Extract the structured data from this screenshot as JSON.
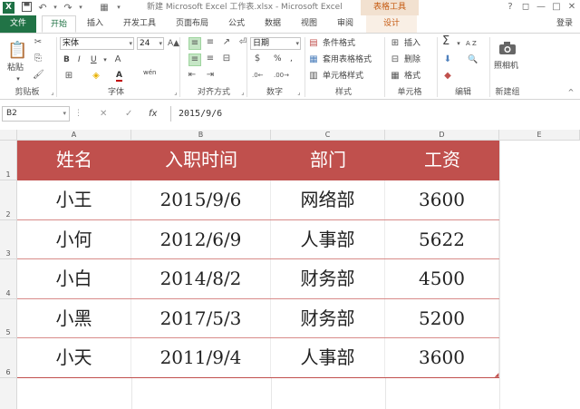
{
  "titlebar": {
    "logo": "X",
    "title": "新建 Microsoft Excel 工作表.xlsx - Microsoft Excel",
    "tool_context": "表格工具",
    "help": "?",
    "restore": "◻",
    "minimize": "—",
    "maximize": "□",
    "close": "✕"
  },
  "tabs": {
    "file": "文件",
    "home": "开始",
    "insert": "插入",
    "developer": "开发工具",
    "page_layout": "页面布局",
    "formulas": "公式",
    "data": "数据",
    "view": "视图",
    "review": "审阅",
    "design": "设计",
    "login": "登录"
  },
  "ribbon": {
    "clipboard": {
      "paste": "粘贴",
      "label": "剪贴板"
    },
    "font": {
      "name": "宋体",
      "size": "24",
      "bold": "B",
      "italic": "I",
      "underline": "U",
      "font_color": "A",
      "wen": "wén",
      "label": "字体"
    },
    "alignment": {
      "label": "对齐方式"
    },
    "number": {
      "format": "日期",
      "percent": "%",
      "comma": ",",
      "label": "数字"
    },
    "styles": {
      "conditional": "条件格式",
      "table_format": "套用表格格式",
      "cell_styles": "单元格样式",
      "label": "样式"
    },
    "cells": {
      "insert": "插入",
      "delete": "删除",
      "format": "格式",
      "label": "单元格"
    },
    "editing": {
      "sum": "Σ",
      "sort": "A Z",
      "find": "🔍",
      "label": "编辑"
    },
    "newgroup": {
      "camera": "照相机",
      "label": "新建组"
    }
  },
  "formula_bar": {
    "name_box": "B2",
    "cancel": "✕",
    "confirm": "✓",
    "fx": "fx",
    "value": "2015/9/6"
  },
  "grid": {
    "columns": [
      "A",
      "B",
      "C",
      "D",
      "E"
    ],
    "rows": [
      "1",
      "2",
      "3",
      "4",
      "5",
      "6"
    ],
    "table": {
      "headers": [
        "姓名",
        "入职时间",
        "部门",
        "工资"
      ],
      "rows": [
        [
          "小王",
          "2015/9/6",
          "网络部",
          "3600"
        ],
        [
          "小何",
          "2012/6/9",
          "人事部",
          "5622"
        ],
        [
          "小白",
          "2014/8/2",
          "财务部",
          "4500"
        ],
        [
          "小黑",
          "2017/5/3",
          "财务部",
          "5200"
        ],
        [
          "小天",
          "2011/9/4",
          "人事部",
          "3600"
        ]
      ]
    }
  },
  "colors": {
    "excel_green": "#217346",
    "table_header": "#c0504d",
    "tool_context": "#c55a11"
  }
}
